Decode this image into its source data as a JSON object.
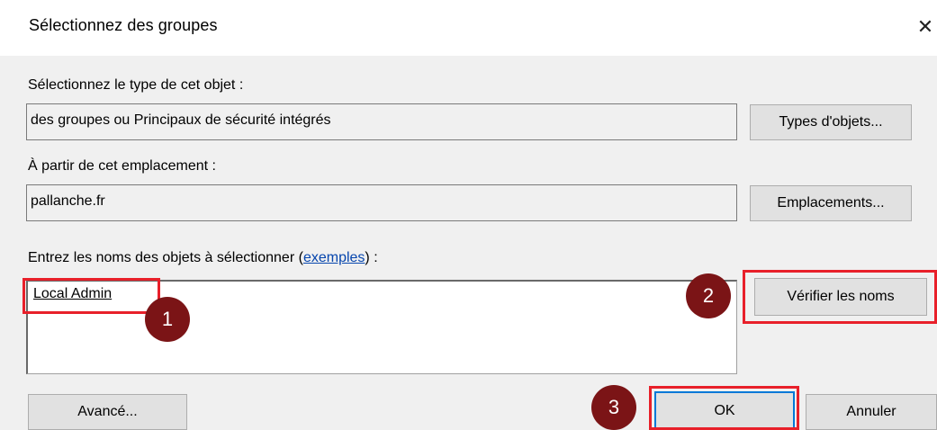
{
  "window": {
    "title": "Sélectionnez des groupes",
    "close_glyph": "✕"
  },
  "object_type": {
    "label": "Sélectionnez le type de cet objet :",
    "value": "des groupes ou Principaux de sécurité intégrés",
    "button_label": "Types d'objets..."
  },
  "location": {
    "label": "À partir de cet emplacement :",
    "value": "pallanche.fr",
    "button_label": "Emplacements..."
  },
  "names": {
    "label_prefix": "Entrez les noms des objets à sélectionner (",
    "examples_link": "exemples",
    "label_suffix": ") :",
    "entered_value": "Local Admin",
    "check_button_label": "Vérifier les noms"
  },
  "footer": {
    "advanced_label": "Avancé...",
    "ok_label": "OK",
    "cancel_label": "Annuler"
  },
  "annotations": {
    "badge_1": "1",
    "badge_2": "2",
    "badge_3": "3",
    "highlight_color": "#e8202a",
    "badge_color": "#7b1416"
  },
  "colors": {
    "dialog_bg": "#f0f0f0",
    "default_button_border": "#0078d7",
    "link": "#0645ad"
  }
}
